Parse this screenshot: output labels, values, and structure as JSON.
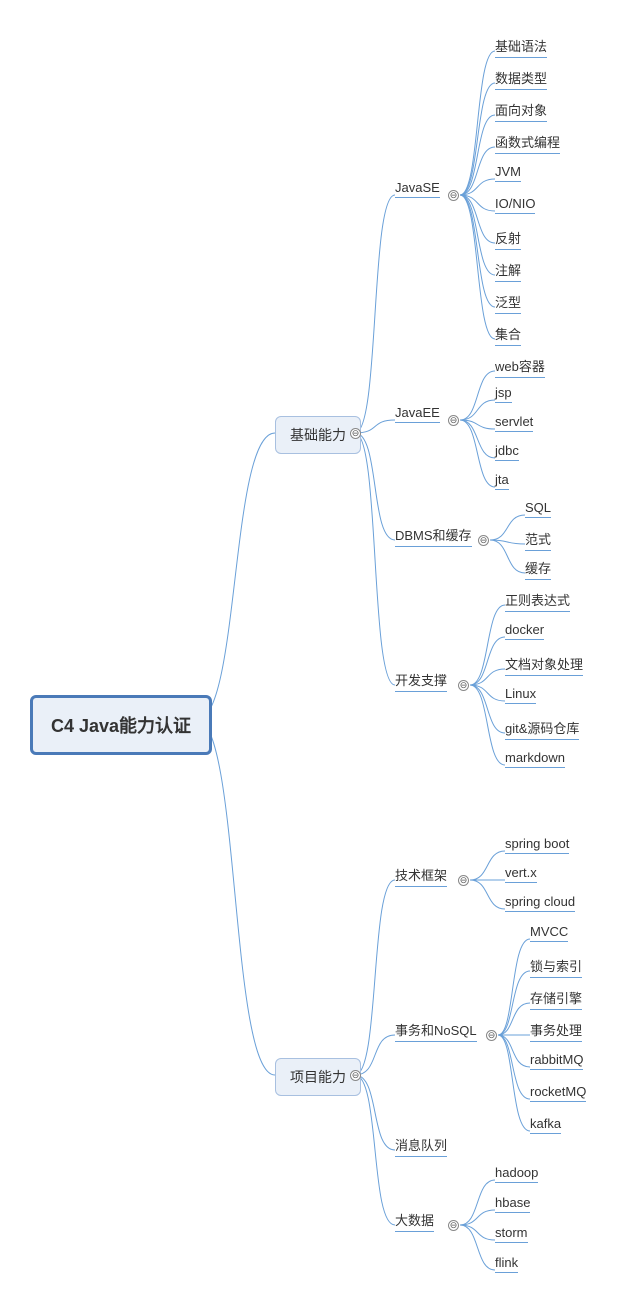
{
  "root": "C4 Java能力认证",
  "branches": [
    {
      "id": "b1",
      "label": "基础能力"
    },
    {
      "id": "b2",
      "label": "项目能力"
    }
  ],
  "mid": {
    "javase": "JavaSE",
    "javaee": "JavaEE",
    "dbms": "DBMS和缓存",
    "dev": "开发支撑",
    "tech": "技术框架",
    "txn": "事务和NoSQL",
    "mq": "消息队列",
    "bigdata": "大数据"
  },
  "leaves": {
    "javase": [
      "基础语法",
      "数据类型",
      "面向对象",
      "函数式编程",
      "JVM",
      "IO/NIO",
      "反射",
      "注解",
      "泛型",
      "集合"
    ],
    "javaee": [
      "web容器",
      "jsp",
      "servlet",
      "jdbc",
      "jta"
    ],
    "dbms": [
      "SQL",
      "范式",
      "缓存"
    ],
    "dev": [
      "正则表达式",
      "docker",
      "文档对象处理",
      "Linux",
      "git&源码仓库",
      "markdown"
    ],
    "tech": [
      "spring boot",
      "vert.x",
      "spring cloud"
    ],
    "txn": [
      "MVCC",
      "锁与索引",
      "存储引擎",
      "事务处理",
      "rabbitMQ",
      "rocketMQ",
      "kafka"
    ],
    "bigdata": [
      "hadoop",
      "hbase",
      "storm",
      "flink"
    ]
  },
  "toggle": "⊖"
}
